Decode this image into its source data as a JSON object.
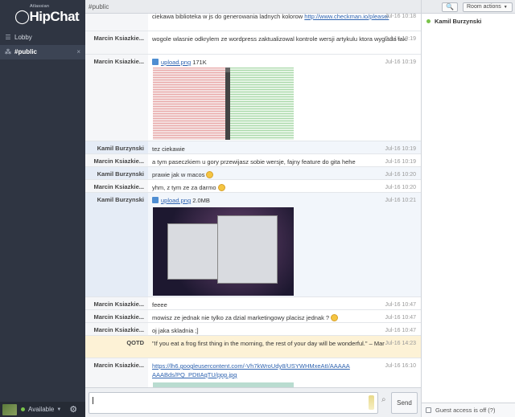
{
  "app": {
    "brand_small": "Atlassian",
    "brand": "HipChat"
  },
  "sidebar": {
    "items": [
      {
        "label": "Lobby",
        "icon": "list-icon"
      },
      {
        "label": "#public",
        "icon": "chat-icon",
        "close": "×"
      }
    ],
    "status": "Available"
  },
  "room": {
    "title": "#public",
    "search_label": "🔍",
    "actions_label": "Room actions"
  },
  "messages": [
    {
      "author": "",
      "text": "ciekawa biblioteka w js do generowania ladnych kolorow",
      "link": "http://www.checkman.io/please/",
      "time": "Jul-16 10:18"
    },
    {
      "author": "Marcin Ksiazkie...",
      "text": "wogole wlasnie odkrylem ze wordpress zaktualizowal kontrole wersji artykulu ktora wyglada tak:",
      "time": "Jul-16 10:19"
    },
    {
      "author": "Marcin Ksiazkie...",
      "file": "upload.png",
      "size": "171K",
      "time": "Jul-16 10:19"
    },
    {
      "author": "Kamil Burzynski",
      "text": "tez ciekawie",
      "time": "Jul-16 10:19"
    },
    {
      "author": "Marcin Ksiazkie...",
      "text": "a tym paseczkiem u gory przewijasz sobie wersje, fajny feature do gita hehe",
      "time": "Jul-16 10:19"
    },
    {
      "author": "Kamil Burzynski",
      "text": "prawie jak w macos",
      "time": "Jul-16 10:20"
    },
    {
      "author": "Marcin Ksiazkie...",
      "text": "yhm, z tym ze za darmo",
      "time": "Jul-16 10:20"
    },
    {
      "author": "Kamil Burzynski",
      "file": "upload.png",
      "size": "2.0MB",
      "time": "Jul-16 10:21"
    },
    {
      "author": "Marcin Ksiazkie...",
      "text": "feeee",
      "time": "Jul-16 10:47"
    },
    {
      "author": "Marcin Ksiazkie...",
      "text": "mowisz ze jednak nie tylko za dzial marketingowy placisz jednak ?",
      "time": "Jul-16 10:47"
    },
    {
      "author": "Marcin Ksiazkie...",
      "text": "oj jaka skladnia ;]",
      "time": "Jul-16 10:47"
    },
    {
      "author": "QOTD",
      "text": "\"If you eat a frog first thing in the morning, the rest of your day will be wonderful.\" – Mark Twain",
      "time": "Jul-16 14:23"
    },
    {
      "author": "Marcin Ksiazkie...",
      "link": "https://lh6.googleusercontent.com/-Vh7kWroUdy8/USYWHMxeAtI/AAAAAAAABds/PQ_PDtIAqTU/ppp.jpg",
      "time": "Jul-16 16:10"
    }
  ],
  "composer": {
    "send_label": "Send"
  },
  "roster": [
    {
      "name": "Kamil Burzynski"
    }
  ],
  "guest": {
    "label": "Guest access is off (?)"
  },
  "colors": {
    "sidebar_bg": "#2f3542",
    "link": "#2e63b0",
    "available": "#79c34a",
    "qotd_bg": "#fdf2d6"
  }
}
